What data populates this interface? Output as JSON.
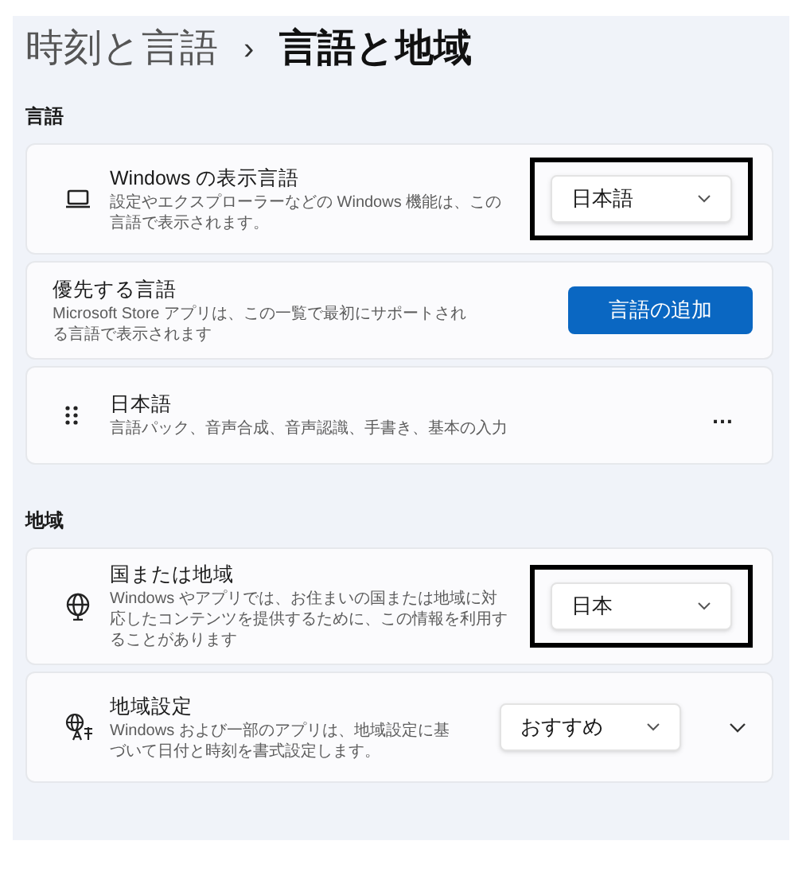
{
  "breadcrumb": {
    "parent": "時刻と言語",
    "separator": "›",
    "current": "言語と地域"
  },
  "sections": [
    {
      "heading": "言語",
      "cards": [
        {
          "kind": "dropdown",
          "title": "Windows の表示言語",
          "description": "設定やエクスプローラーなどの Windows 機能は、この言語で表示されます。",
          "value": "日本語",
          "highlighted": true,
          "expandable": false
        },
        {
          "kind": "button",
          "title": "優先する言語",
          "description": "Microsoft Store アプリは、この一覧で最初にサポートされる言語で表示されます",
          "button": "言語の追加"
        },
        {
          "kind": "language",
          "title": "日本語",
          "description": "言語パック、音声合成、音声認識、手書き、基本の入力",
          "more": "…"
        }
      ]
    },
    {
      "heading": "地域",
      "cards": [
        {
          "kind": "dropdown",
          "title": "国または地域",
          "description": "Windows やアプリでは、お住まいの国または地域に対応したコンテンツを提供するために、この情報を利用することがあります",
          "value": "日本",
          "highlighted": true,
          "expandable": false
        },
        {
          "kind": "dropdown",
          "title": "地域設定",
          "description": "Windows および一部のアプリは、地域設定に基づいて日付と時刻を書式設定します。",
          "value": "おすすめ",
          "highlighted": false,
          "expandable": true
        }
      ]
    }
  ]
}
